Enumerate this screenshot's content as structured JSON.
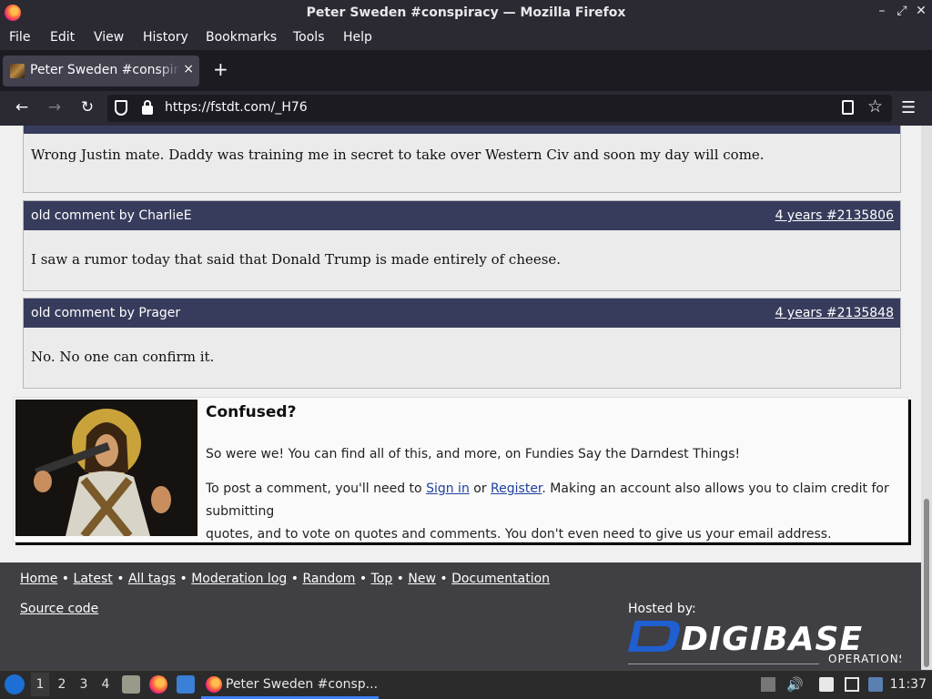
{
  "window": {
    "title": "Peter Sweden #conspiracy — Mozilla Firefox"
  },
  "menu": [
    "File",
    "Edit",
    "View",
    "History",
    "Bookmarks",
    "Tools",
    "Help"
  ],
  "tab": {
    "title": "Peter Sweden #conspiracy",
    "close": "×",
    "new": "+"
  },
  "nav": {
    "url": "https://fstdt.com/_H76"
  },
  "comments": [
    {
      "body": "Wrong Justin mate. Daddy was training me in secret to take over Western Civ and soon my day will come."
    },
    {
      "author": "old comment by CharlieE",
      "meta": "4 years #2135806",
      "body": "I saw a rumor today that said that Donald Trump is made entirely of cheese."
    },
    {
      "author": "old comment by Prager",
      "meta": "4 years #2135848",
      "body": "No. No one can confirm it."
    }
  ],
  "confused": {
    "heading": "Confused?",
    "line1": "So were we! You can find all of this, and more, on Fundies Say the Darndest Things!",
    "line2_pre": "To post a comment, you'll need to ",
    "signin": "Sign in",
    "or": " or ",
    "register": "Register",
    "line2_post": ". Making an account also allows you to claim credit for submitting",
    "line3": "quotes, and to vote on quotes and comments. You don't even need to give us your email address."
  },
  "footer": {
    "links": [
      "Home",
      "Latest",
      "All tags",
      "Moderation log",
      "Random",
      "Top",
      "New",
      "Documentation"
    ],
    "separator": " • ",
    "source": "Source code",
    "hosted": "Hosted by:",
    "logo_text": "DIGIBASE",
    "logo_sub": "OPERATIONS"
  },
  "taskbar": {
    "workspaces": [
      "1",
      "2",
      "3",
      "4"
    ],
    "task_title": "Peter Sweden #consp...",
    "clock": "11:37"
  }
}
